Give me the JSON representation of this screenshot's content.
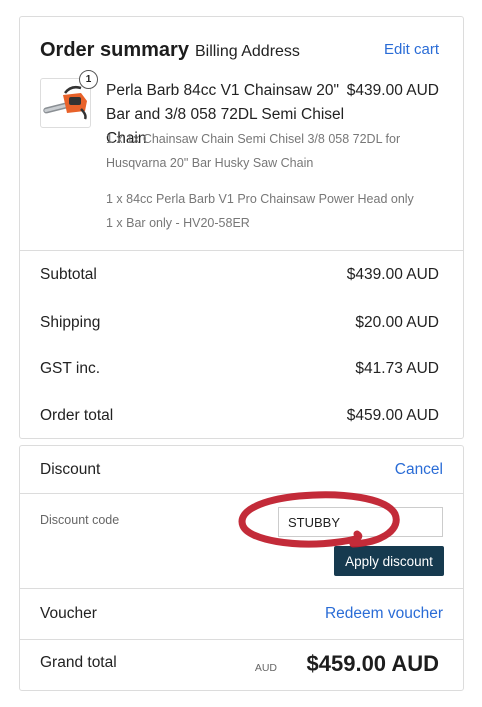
{
  "summary": {
    "title": "Order summary",
    "subtitle": "Billing Address",
    "edit_cart": "Edit cart",
    "item": {
      "quantity_badge": "1",
      "image": "chainsaw-product-image",
      "title": "Perla Barb 84cc V1 Chainsaw 20\" Bar and 3/8 058 72DL Semi Chisel Chain",
      "price": "$439.00 AUD",
      "options": [
        "1 x 1x Chainsaw Chain Semi Chisel 3/8 058 72DL for Husqvarna 20\" Bar Husky Saw Chain",
        "1 x 84cc Perla Barb V1 Pro Chainsaw Power Head only",
        "1 x Bar only - HV20-58ER"
      ]
    },
    "totals": [
      {
        "label": "Subtotal",
        "value": "$439.00 AUD"
      },
      {
        "label": "Shipping",
        "value": "$20.00 AUD"
      },
      {
        "label": "GST inc.",
        "value": "$41.73 AUD"
      },
      {
        "label": "Order total",
        "value": "$459.00 AUD"
      }
    ]
  },
  "discount": {
    "title": "Discount",
    "cancel": "Cancel",
    "code_label": "Discount code",
    "code_value": "STUBBY",
    "apply_button": "Apply discount",
    "annotation_color": "#c0202e"
  },
  "voucher": {
    "label": "Voucher",
    "link": "Redeem voucher"
  },
  "grand_total": {
    "label": "Grand total",
    "currency_prefix": "AUD",
    "value": "$459.00 AUD"
  }
}
